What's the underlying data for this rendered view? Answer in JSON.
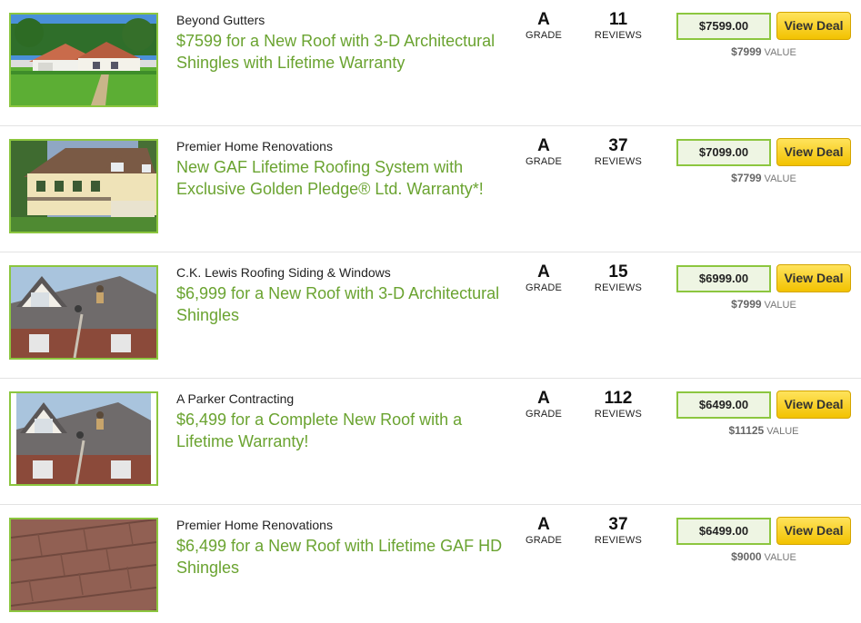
{
  "deals": [
    {
      "vendor": "Beyond Gutters",
      "title": "$7599 for a New Roof with 3-D Architectural Shingles with Lifetime Warranty",
      "grade": "A",
      "grade_label": "GRADE",
      "reviews": "11",
      "reviews_label": "REVIEWS",
      "price": "$7599.00",
      "button": "View Deal",
      "value": "$7999",
      "value_label": "VALUE",
      "image": "ranch-house-lawn"
    },
    {
      "vendor": "Premier Home Renovations",
      "title": "New GAF Lifetime Roofing System with Exclusive Golden Pledge® Ltd. Warranty*!",
      "grade": "A",
      "grade_label": "GRADE",
      "reviews": "37",
      "reviews_label": "REVIEWS",
      "price": "$7099.00",
      "button": "View Deal",
      "value": "$7799",
      "value_label": "VALUE",
      "image": "two-story-house"
    },
    {
      "vendor": "C.K. Lewis Roofing Siding & Windows",
      "title": "$6,999 for a New Roof with 3-D Architectural Shingles",
      "grade": "A",
      "grade_label": "GRADE",
      "reviews": "15",
      "reviews_label": "REVIEWS",
      "price": "$6999.00",
      "button": "View Deal",
      "value": "$7999",
      "value_label": "VALUE",
      "image": "roofers-on-roof"
    },
    {
      "vendor": "A Parker Contracting",
      "title": "$6,499 for a Complete New Roof with a Lifetime Warranty!",
      "grade": "A",
      "grade_label": "GRADE",
      "reviews": "112",
      "reviews_label": "REVIEWS",
      "price": "$6499.00",
      "button": "View Deal",
      "value": "$11125",
      "value_label": "VALUE",
      "image": "roofers-on-roof"
    },
    {
      "vendor": "Premier Home Renovations",
      "title": "$6,499 for a New Roof with Lifetime GAF HD Shingles",
      "grade": "A",
      "grade_label": "GRADE",
      "reviews": "37",
      "reviews_label": "REVIEWS",
      "price": "$6499.00",
      "button": "View Deal",
      "value": "$9000",
      "value_label": "VALUE",
      "image": "shingles-closeup"
    }
  ],
  "colors": {
    "accent_green": "#6aa330",
    "border_green": "#8cc63f",
    "button_yellow": "#f2c200"
  }
}
